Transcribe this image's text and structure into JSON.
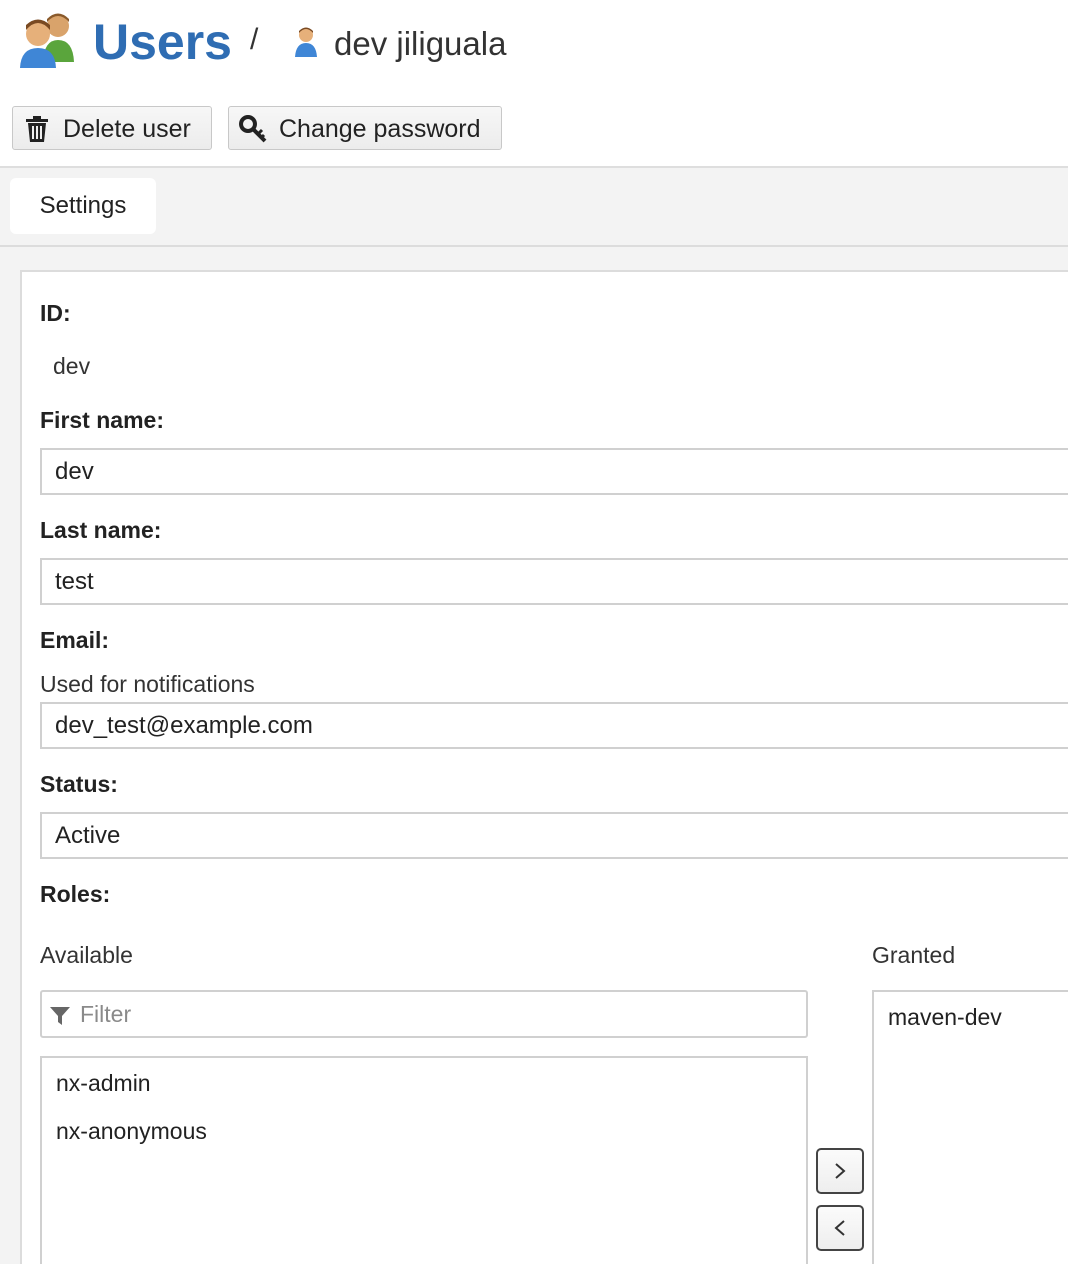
{
  "header": {
    "section_title": "Users",
    "separator": "/",
    "user_display_name": "dev jiliguala"
  },
  "toolbar": {
    "delete_label": "Delete user",
    "change_password_label": "Change password"
  },
  "tabs": [
    {
      "label": "Settings",
      "active": true
    }
  ],
  "form": {
    "id_label": "ID:",
    "id_value": "dev",
    "first_name_label": "First name:",
    "first_name_value": "dev",
    "last_name_label": "Last name:",
    "last_name_value": "test",
    "email_label": "Email:",
    "email_help": "Used for notifications",
    "email_value": "dev_test@example.com",
    "status_label": "Status:",
    "status_value": "Active",
    "roles_label": "Roles:"
  },
  "roles": {
    "available_label": "Available",
    "granted_label": "Granted",
    "filter_placeholder": "Filter",
    "available": [
      "nx-admin",
      "nx-anonymous"
    ],
    "granted": [
      "maven-dev"
    ]
  },
  "icons": {
    "users": "users-icon",
    "user": "user-icon",
    "delete": "trash-icon",
    "password": "key-icon",
    "filter": "filter-icon",
    "move_right": "chevron-right-icon",
    "move_left": "chevron-left-icon"
  },
  "colors": {
    "title_blue": "#2f6db3",
    "border": "#d0d0d0",
    "background": "#f3f3f3"
  }
}
